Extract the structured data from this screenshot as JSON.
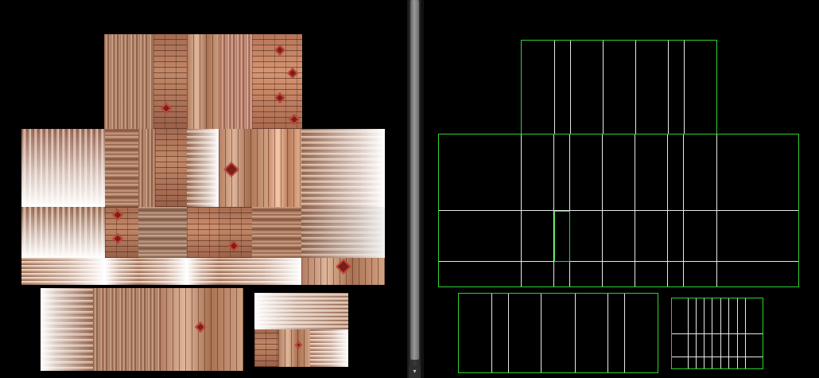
{
  "scrollbar": {
    "down_arrow": "▾"
  },
  "icons": {
    "scroll_down": "triangle-down-icon"
  },
  "colors": {
    "wire_outline": "#2fd12f",
    "wire_grid": "#e8e8e8",
    "background": "#000000",
    "motif": "#7a1e1a"
  }
}
